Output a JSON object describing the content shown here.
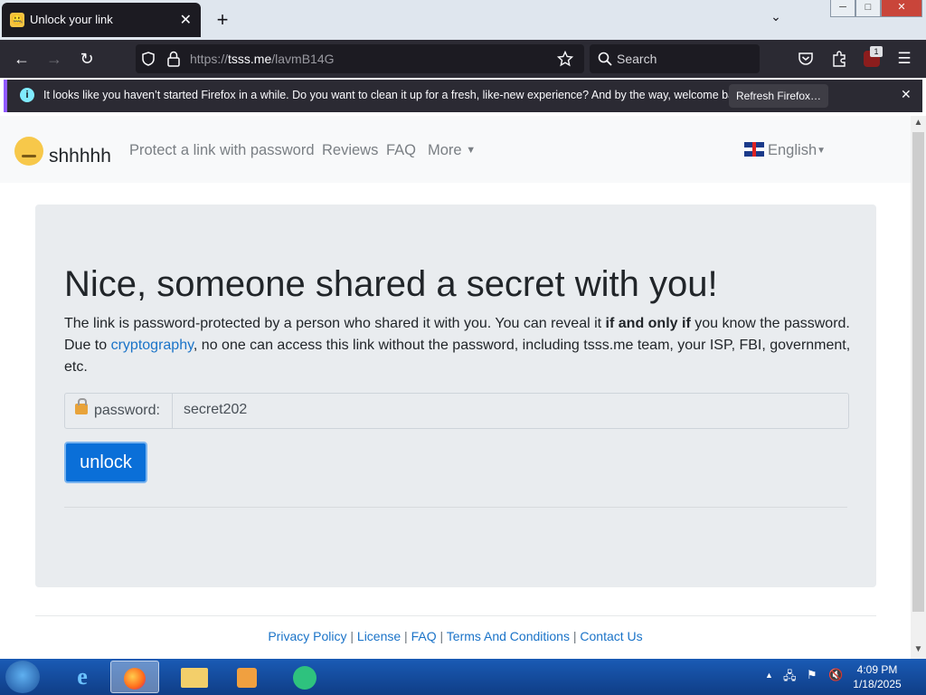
{
  "browser": {
    "tab_title": "Unlock your link",
    "tab_close": "✕",
    "new_tab": "+",
    "url_scheme": "https://",
    "url_host": "tsss.me",
    "url_path": "/lavmB14G",
    "search_placeholder": "Search",
    "extension_badge": "1"
  },
  "notification": {
    "message": "It looks like you haven’t started Firefox in a while. Do you want to clean it up for a fresh, like-new experience? And by the way, welcome back!",
    "button": "Refresh Firefox…"
  },
  "site": {
    "brand": "shhhhh",
    "nav": [
      "Protect a link with password",
      "Reviews",
      "FAQ",
      "More"
    ],
    "language": "English",
    "heading": "Nice, someone shared a secret with you!",
    "lead_part1": "The link is password-protected by a person who shared it with you. You can reveal it ",
    "lead_bold": "if and only if",
    "lead_part2": " you know the password. Due to ",
    "lead_link": "cryptography",
    "lead_part3": ", no one can access this link without the password, including tsss.me team, your ISP, FBI, government, etc.",
    "password_label": "password:",
    "password_value": "secret202",
    "unlock_button": "unlock",
    "footer_links": [
      "Privacy Policy",
      "License",
      "FAQ",
      "Terms And Conditions",
      "Contact Us"
    ]
  },
  "taskbar": {
    "time": "4:09 PM",
    "date": "1/18/2025"
  },
  "colors": {
    "firefox_dark": "#2b2a33",
    "accent_blue": "#0a6fd8",
    "link_blue": "#1a73c8"
  }
}
